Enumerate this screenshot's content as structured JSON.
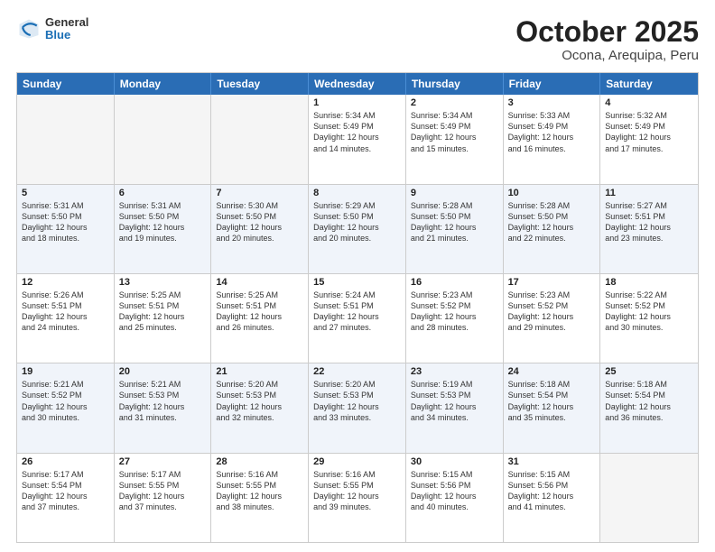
{
  "header": {
    "logo": {
      "general": "General",
      "blue": "Blue"
    },
    "title": "October 2025",
    "location": "Ocona, Arequipa, Peru"
  },
  "dayHeaders": [
    "Sunday",
    "Monday",
    "Tuesday",
    "Wednesday",
    "Thursday",
    "Friday",
    "Saturday"
  ],
  "weeks": [
    {
      "alt": false,
      "days": [
        {
          "num": "",
          "info": "",
          "empty": true
        },
        {
          "num": "",
          "info": "",
          "empty": true
        },
        {
          "num": "",
          "info": "",
          "empty": true
        },
        {
          "num": "1",
          "info": "Sunrise: 5:34 AM\nSunset: 5:49 PM\nDaylight: 12 hours\nand 14 minutes."
        },
        {
          "num": "2",
          "info": "Sunrise: 5:34 AM\nSunset: 5:49 PM\nDaylight: 12 hours\nand 15 minutes."
        },
        {
          "num": "3",
          "info": "Sunrise: 5:33 AM\nSunset: 5:49 PM\nDaylight: 12 hours\nand 16 minutes."
        },
        {
          "num": "4",
          "info": "Sunrise: 5:32 AM\nSunset: 5:49 PM\nDaylight: 12 hours\nand 17 minutes."
        }
      ]
    },
    {
      "alt": true,
      "days": [
        {
          "num": "5",
          "info": "Sunrise: 5:31 AM\nSunset: 5:50 PM\nDaylight: 12 hours\nand 18 minutes."
        },
        {
          "num": "6",
          "info": "Sunrise: 5:31 AM\nSunset: 5:50 PM\nDaylight: 12 hours\nand 19 minutes."
        },
        {
          "num": "7",
          "info": "Sunrise: 5:30 AM\nSunset: 5:50 PM\nDaylight: 12 hours\nand 20 minutes."
        },
        {
          "num": "8",
          "info": "Sunrise: 5:29 AM\nSunset: 5:50 PM\nDaylight: 12 hours\nand 20 minutes."
        },
        {
          "num": "9",
          "info": "Sunrise: 5:28 AM\nSunset: 5:50 PM\nDaylight: 12 hours\nand 21 minutes."
        },
        {
          "num": "10",
          "info": "Sunrise: 5:28 AM\nSunset: 5:50 PM\nDaylight: 12 hours\nand 22 minutes."
        },
        {
          "num": "11",
          "info": "Sunrise: 5:27 AM\nSunset: 5:51 PM\nDaylight: 12 hours\nand 23 minutes."
        }
      ]
    },
    {
      "alt": false,
      "days": [
        {
          "num": "12",
          "info": "Sunrise: 5:26 AM\nSunset: 5:51 PM\nDaylight: 12 hours\nand 24 minutes."
        },
        {
          "num": "13",
          "info": "Sunrise: 5:25 AM\nSunset: 5:51 PM\nDaylight: 12 hours\nand 25 minutes."
        },
        {
          "num": "14",
          "info": "Sunrise: 5:25 AM\nSunset: 5:51 PM\nDaylight: 12 hours\nand 26 minutes."
        },
        {
          "num": "15",
          "info": "Sunrise: 5:24 AM\nSunset: 5:51 PM\nDaylight: 12 hours\nand 27 minutes."
        },
        {
          "num": "16",
          "info": "Sunrise: 5:23 AM\nSunset: 5:52 PM\nDaylight: 12 hours\nand 28 minutes."
        },
        {
          "num": "17",
          "info": "Sunrise: 5:23 AM\nSunset: 5:52 PM\nDaylight: 12 hours\nand 29 minutes."
        },
        {
          "num": "18",
          "info": "Sunrise: 5:22 AM\nSunset: 5:52 PM\nDaylight: 12 hours\nand 30 minutes."
        }
      ]
    },
    {
      "alt": true,
      "days": [
        {
          "num": "19",
          "info": "Sunrise: 5:21 AM\nSunset: 5:52 PM\nDaylight: 12 hours\nand 30 minutes."
        },
        {
          "num": "20",
          "info": "Sunrise: 5:21 AM\nSunset: 5:53 PM\nDaylight: 12 hours\nand 31 minutes."
        },
        {
          "num": "21",
          "info": "Sunrise: 5:20 AM\nSunset: 5:53 PM\nDaylight: 12 hours\nand 32 minutes."
        },
        {
          "num": "22",
          "info": "Sunrise: 5:20 AM\nSunset: 5:53 PM\nDaylight: 12 hours\nand 33 minutes."
        },
        {
          "num": "23",
          "info": "Sunrise: 5:19 AM\nSunset: 5:53 PM\nDaylight: 12 hours\nand 34 minutes."
        },
        {
          "num": "24",
          "info": "Sunrise: 5:18 AM\nSunset: 5:54 PM\nDaylight: 12 hours\nand 35 minutes."
        },
        {
          "num": "25",
          "info": "Sunrise: 5:18 AM\nSunset: 5:54 PM\nDaylight: 12 hours\nand 36 minutes."
        }
      ]
    },
    {
      "alt": false,
      "days": [
        {
          "num": "26",
          "info": "Sunrise: 5:17 AM\nSunset: 5:54 PM\nDaylight: 12 hours\nand 37 minutes."
        },
        {
          "num": "27",
          "info": "Sunrise: 5:17 AM\nSunset: 5:55 PM\nDaylight: 12 hours\nand 37 minutes."
        },
        {
          "num": "28",
          "info": "Sunrise: 5:16 AM\nSunset: 5:55 PM\nDaylight: 12 hours\nand 38 minutes."
        },
        {
          "num": "29",
          "info": "Sunrise: 5:16 AM\nSunset: 5:55 PM\nDaylight: 12 hours\nand 39 minutes."
        },
        {
          "num": "30",
          "info": "Sunrise: 5:15 AM\nSunset: 5:56 PM\nDaylight: 12 hours\nand 40 minutes."
        },
        {
          "num": "31",
          "info": "Sunrise: 5:15 AM\nSunset: 5:56 PM\nDaylight: 12 hours\nand 41 minutes."
        },
        {
          "num": "",
          "info": "",
          "empty": true
        }
      ]
    }
  ]
}
